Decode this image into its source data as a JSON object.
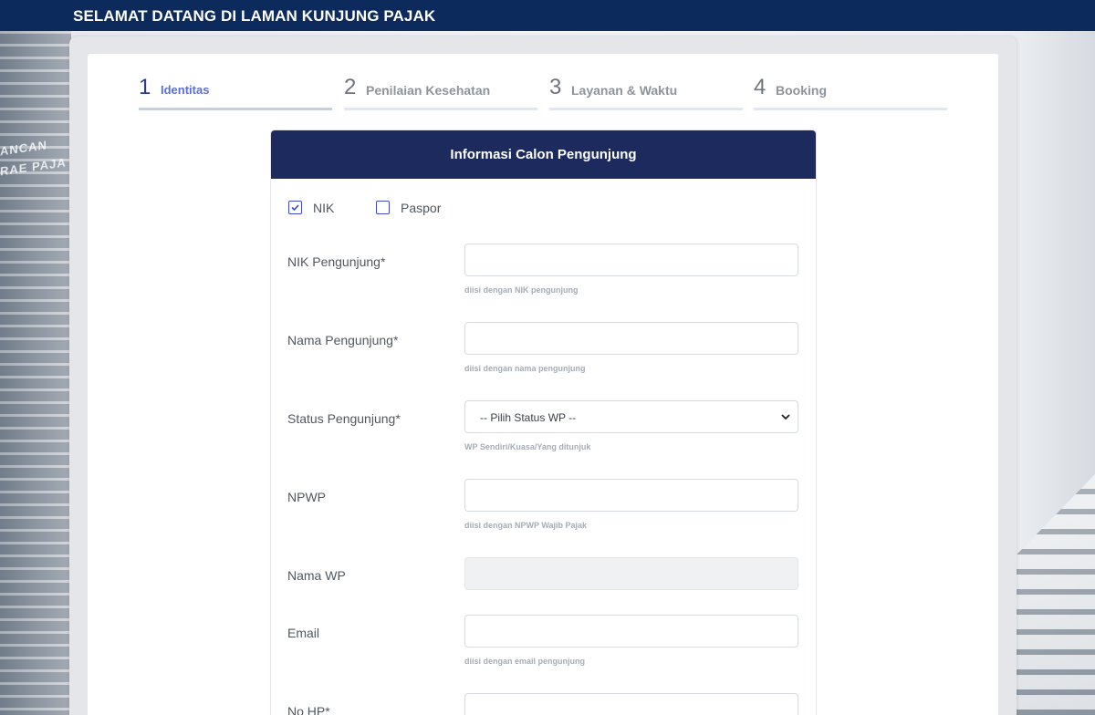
{
  "header": {
    "title": "SELAMAT DATANG DI LAMAN KUNJUNG PAJAK"
  },
  "background": {
    "sign_text_1": "ANCAN",
    "sign_text_2": "RAE PAJA"
  },
  "steps": [
    {
      "number": "1",
      "label": "Identitas",
      "active": true
    },
    {
      "number": "2",
      "label": "Penilaian Kesehatan",
      "active": false
    },
    {
      "number": "3",
      "label": "Layanan & Waktu",
      "active": false
    },
    {
      "number": "4",
      "label": "Booking",
      "active": false
    }
  ],
  "form": {
    "title": "Informasi Calon Pengunjung",
    "id_type": [
      {
        "label": "NIK",
        "checked": true
      },
      {
        "label": "Paspor",
        "checked": false
      }
    ],
    "fields": {
      "nik": {
        "label": "NIK Pengunjung*",
        "value": "",
        "help": "diisi dengan NIK pengunjung"
      },
      "nama": {
        "label": "Nama Pengunjung*",
        "value": "",
        "help": "diisi dengan nama pengunjung"
      },
      "status": {
        "label": "Status Pengunjung*",
        "selected": "-- Pilih Status WP --",
        "help": "WP Sendiri/Kuasa/Yang ditunjuk"
      },
      "npwp": {
        "label": "NPWP",
        "value": "",
        "help": "diisi dengan NPWP Wajib Pajak"
      },
      "nama_wp": {
        "label": "Nama WP",
        "value": ""
      },
      "email": {
        "label": "Email",
        "value": "",
        "help": "diisi dengan email pengunjung"
      },
      "hp": {
        "label": "No HP*",
        "value": ""
      }
    }
  },
  "colors": {
    "topbar": "#0c2a5c",
    "panel_header": "#1d2a5e",
    "accent": "#3b49c9",
    "active_step": "#5b6fd6"
  },
  "icons": {
    "checked": "check-icon",
    "dropdown": "chevron-down-icon"
  }
}
